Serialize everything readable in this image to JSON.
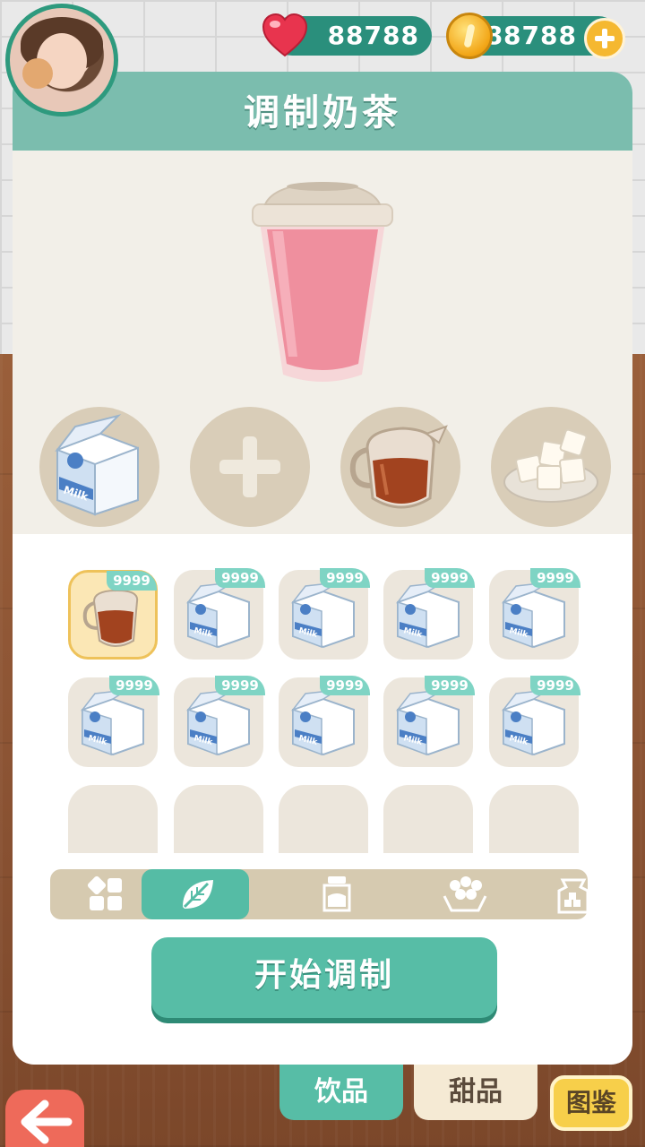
{
  "hud": {
    "hearts": "88788",
    "coins": "88788"
  },
  "panel": {
    "title": "调制奶茶",
    "start_button": "开始调制"
  },
  "slots": [
    {
      "item": "milk-carton"
    },
    {
      "item": "empty"
    },
    {
      "item": "tea-pitcher"
    },
    {
      "item": "sugar-cubes"
    }
  ],
  "inventory": {
    "rows": [
      [
        {
          "item": "tea-pitcher",
          "count": "9999",
          "selected": true
        },
        {
          "item": "milk-carton",
          "count": "9999"
        },
        {
          "item": "milk-carton",
          "count": "9999"
        },
        {
          "item": "milk-carton",
          "count": "9999"
        },
        {
          "item": "milk-carton",
          "count": "9999"
        }
      ],
      [
        {
          "item": "milk-carton",
          "count": "9999"
        },
        {
          "item": "milk-carton",
          "count": "9999"
        },
        {
          "item": "milk-carton",
          "count": "9999"
        },
        {
          "item": "milk-carton",
          "count": "9999"
        },
        {
          "item": "milk-carton",
          "count": "9999"
        }
      ]
    ],
    "milk_label": "Milk"
  },
  "categories": [
    {
      "icon": "grid-icon",
      "active": false
    },
    {
      "icon": "leaf-icon",
      "active": true
    },
    {
      "icon": "bottle-icon",
      "active": false
    },
    {
      "icon": "pearls-icon",
      "active": false
    },
    {
      "icon": "sugar-bag-icon",
      "active": false
    }
  ],
  "bottom_tabs": {
    "drinks": "饮品",
    "desserts": "甜品",
    "album": "图鉴"
  },
  "colors": {
    "accent": "#57bda6",
    "header": "#7bbdae",
    "cup_fill": "#f08a9a"
  }
}
